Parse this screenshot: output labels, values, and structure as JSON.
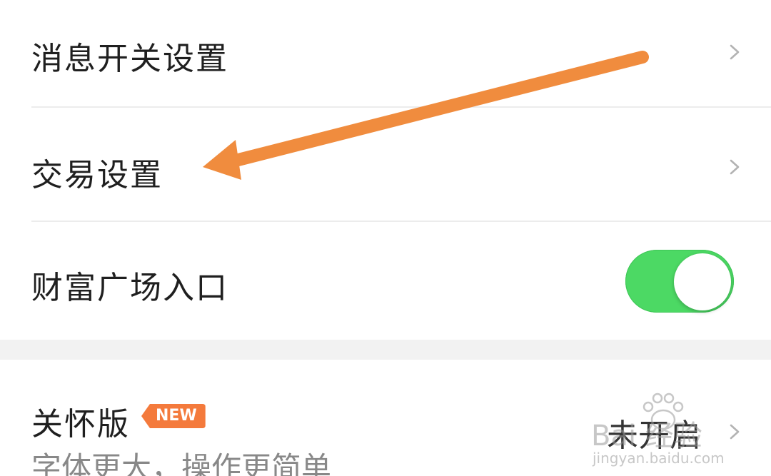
{
  "settings": {
    "items": [
      {
        "label": "消息开关设置",
        "control": "chevron"
      },
      {
        "label": "交易设置",
        "control": "chevron"
      },
      {
        "label": "财富广场入口",
        "control": "toggle",
        "toggle_on": true
      }
    ],
    "care_mode": {
      "label": "关怀版",
      "badge": "NEW",
      "value": "未开启",
      "subtitle": "字体更大，操作更简单"
    }
  },
  "watermark": {
    "brand": "Bai 经验",
    "url": "jingyan.baidu.com"
  },
  "colors": {
    "toggle_on": "#4cd964",
    "badge": "#f47a3c",
    "annotation_arrow": "#f08c3e"
  },
  "icons": {
    "row_chevron": "chevron-right-icon",
    "annotation": "arrow-annotation-icon",
    "watermark_logo": "paw-logo-icon"
  }
}
